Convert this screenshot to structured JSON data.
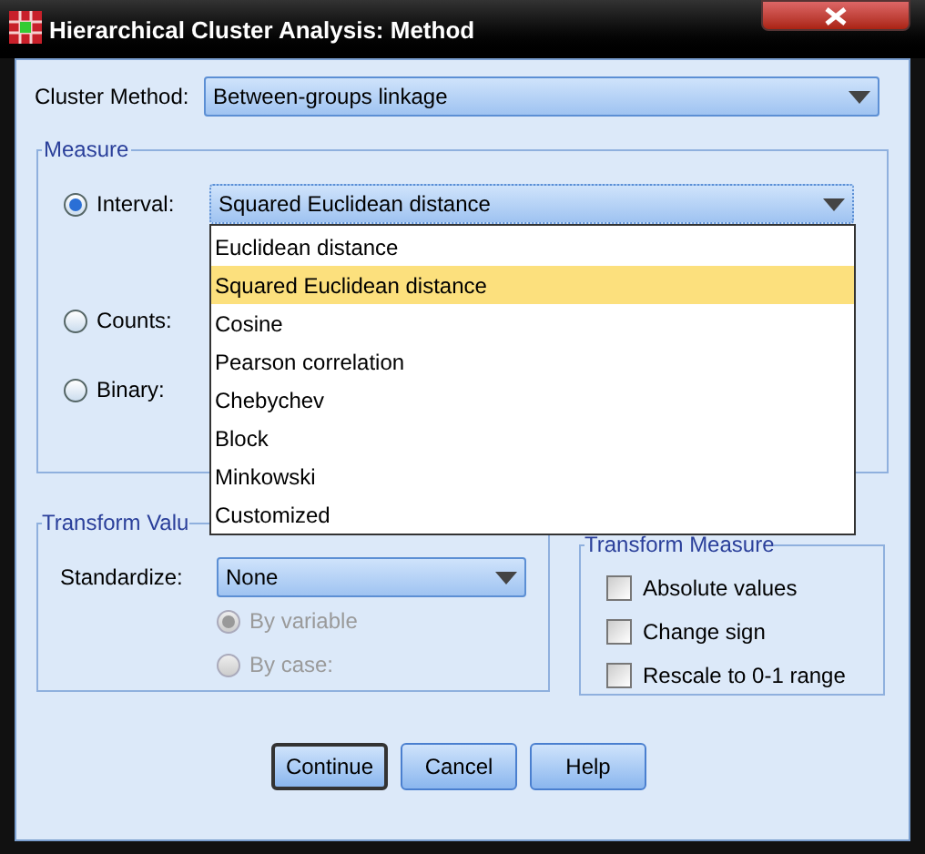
{
  "window": {
    "title": "Hierarchical Cluster Analysis: Method"
  },
  "cluster_method": {
    "label": "Cluster Method:",
    "value": "Between-groups linkage"
  },
  "measure": {
    "title": "Measure",
    "options": [
      {
        "label": "Interval:",
        "selected": true
      },
      {
        "label": "Counts:",
        "selected": false
      },
      {
        "label": "Binary:",
        "selected": false
      }
    ],
    "interval_select": {
      "value": "Squared Euclidean distance",
      "expanded": true,
      "items": [
        {
          "label": "Euclidean distance",
          "selected": false
        },
        {
          "label": "Squared Euclidean distance",
          "selected": true
        },
        {
          "label": "Cosine",
          "selected": false
        },
        {
          "label": "Pearson correlation",
          "selected": false
        },
        {
          "label": "Chebychev",
          "selected": false
        },
        {
          "label": "Block",
          "selected": false
        },
        {
          "label": "Minkowski",
          "selected": false
        },
        {
          "label": "Customized",
          "selected": false
        }
      ]
    }
  },
  "transform_values": {
    "title": "Transform Valu",
    "standardize": {
      "label": "Standardize:",
      "value": "None"
    },
    "options": [
      {
        "label": "By variable",
        "selected": true,
        "disabled": true
      },
      {
        "label": "By case:",
        "selected": false,
        "disabled": true
      }
    ]
  },
  "transform_measure": {
    "title": "Transform Measure",
    "options": [
      {
        "label": "Absolute values",
        "checked": false
      },
      {
        "label": "Change sign",
        "checked": false
      },
      {
        "label": "Rescale to 0-1 range",
        "checked": false
      }
    ]
  },
  "buttons": [
    {
      "label": "Continue",
      "default": true
    },
    {
      "label": "Cancel",
      "default": false
    },
    {
      "label": "Help",
      "default": false
    }
  ]
}
